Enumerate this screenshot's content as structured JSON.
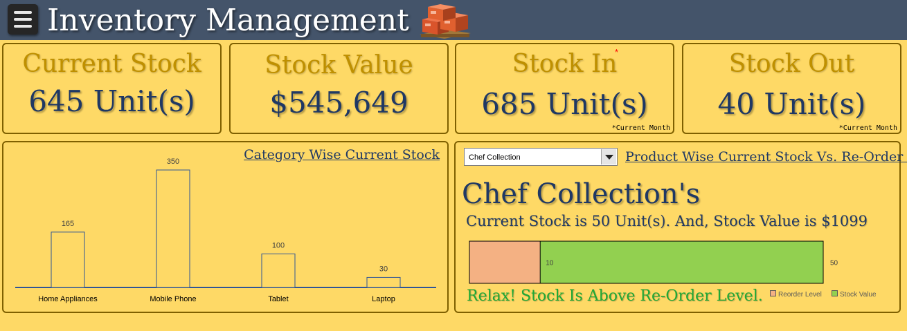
{
  "header": {
    "title": "Inventory Management",
    "menu_icon": "hamburger-menu-icon",
    "logo_icon": "boxes-on-pallet-icon",
    "background": "#44546a"
  },
  "kpis": {
    "current_stock": {
      "label": "Current Stock",
      "value": "645 Unit(s)"
    },
    "stock_value": {
      "label": "Stock Value",
      "value": "$545,649"
    },
    "stock_in": {
      "label": "Stock In",
      "asterisk": "*",
      "value": "685 Unit(s)",
      "note": "*Current Month"
    },
    "stock_out": {
      "label": "Stock Out",
      "value": "40 Unit(s)",
      "note": "*Current Month"
    }
  },
  "category_panel": {
    "title": "Category Wise Current Stock"
  },
  "product_panel": {
    "dropdown": {
      "selected": "Chef Collection"
    },
    "title": "Product Wise Current Stock Vs. Re-Order Level",
    "heading": "Chef Collection's",
    "sentence": "Current Stock is 50 Unit(s). And, Stock Value is $1099",
    "status": "Relax! Stock Is Above Re-Order Level.",
    "legend": {
      "reorder": "Reorder Level",
      "stock": "Stock Value"
    }
  },
  "chart_data": [
    {
      "type": "bar",
      "title": "Category Wise Current Stock",
      "categories": [
        "Home Appliances",
        "Mobile Phone",
        "Tablet",
        "Laptop"
      ],
      "values": [
        165,
        350,
        100,
        30
      ],
      "data_labels": [
        "165",
        "350",
        "100",
        "30"
      ],
      "ylim": [
        0,
        350
      ],
      "grid": false,
      "legend": "none",
      "colors": {
        "bar_fill": "#fed966",
        "bar_stroke": "#2f5597",
        "axis": "#2f5597"
      }
    },
    {
      "type": "bar",
      "orientation": "horizontal-overlap",
      "title": "Product Wise Current Stock Vs. Re-Order Level",
      "series": [
        {
          "name": "Reorder Level",
          "value": 10,
          "label": "10",
          "color": "#f4b183"
        },
        {
          "name": "Stock Value",
          "value": 50,
          "label": "50",
          "color": "#92d050"
        }
      ],
      "xlim": [
        0,
        50
      ],
      "legend": "bottom-right"
    }
  ]
}
